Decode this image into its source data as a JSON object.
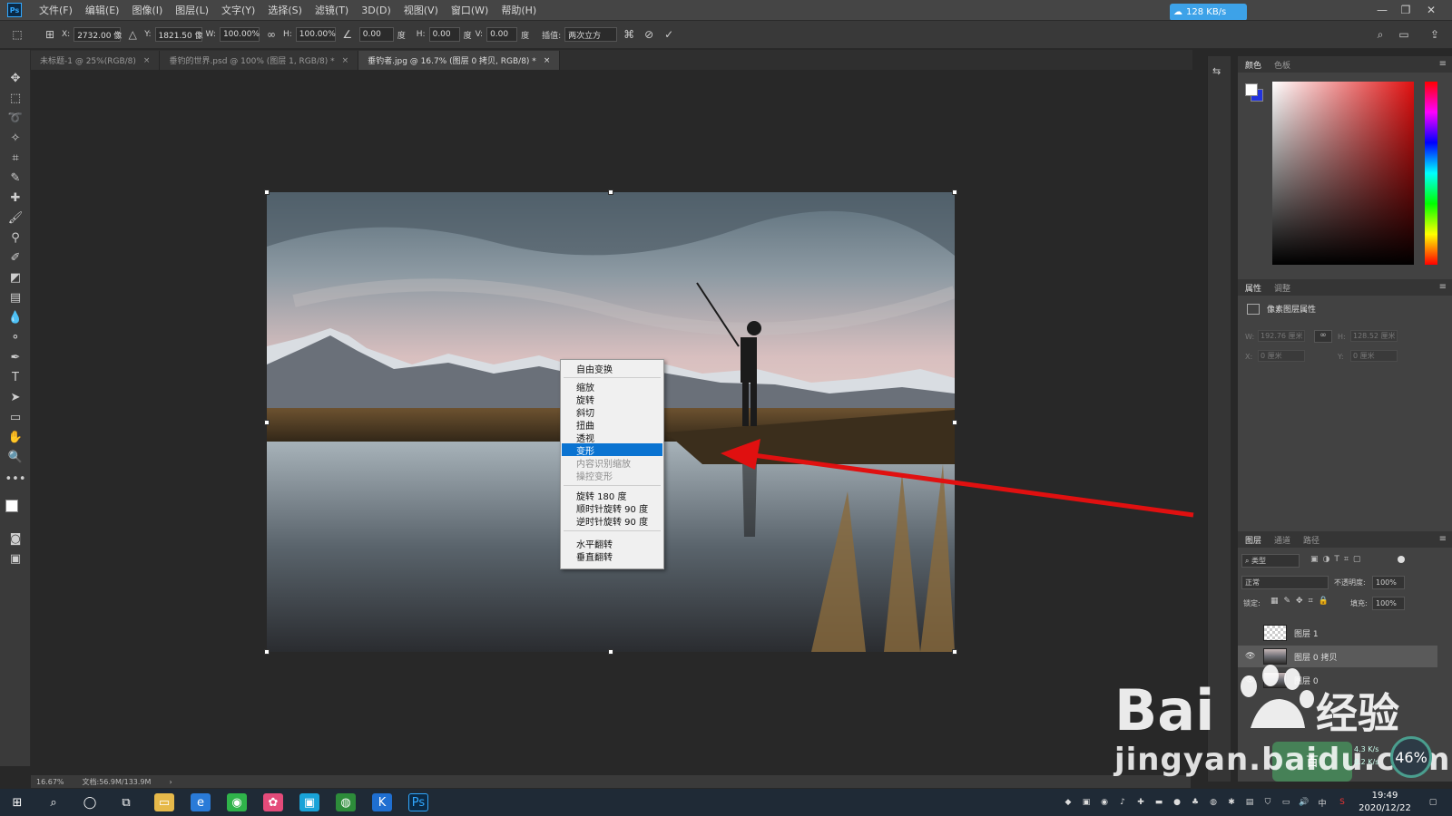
{
  "app": {
    "logo_text": "Ps"
  },
  "menu": [
    "文件(F)",
    "编辑(E)",
    "图像(I)",
    "图层(L)",
    "文字(Y)",
    "选择(S)",
    "滤镜(T)",
    "3D(D)",
    "视图(V)",
    "窗口(W)",
    "帮助(H)"
  ],
  "net_badge": "128 KB/s",
  "options": {
    "x_label": "X:",
    "x_value": "2732.00 像",
    "y_label": "Y:",
    "y_value": "1821.50 像",
    "w_label": "W:",
    "w_value": "100.00%",
    "h_label": "H:",
    "h_value": "100.00%",
    "angle_value": "0.00",
    "angle_unit": "度",
    "hskew_label": "H:",
    "hskew_value": "0.00",
    "hskew_unit": "度",
    "vskew_label": "V:",
    "vskew_value": "0.00",
    "vskew_unit": "度",
    "interp_label": "插值:",
    "interp_value": "两次立方"
  },
  "tabs": [
    {
      "label": "未标题-1 @ 25%(RGB/8)",
      "active": false
    },
    {
      "label": "垂钓的世界.psd @ 100% (图层 1, RGB/8) *",
      "active": false
    },
    {
      "label": "垂钓者.jpg @ 16.7% (图层 0 拷贝, RGB/8) *",
      "active": true
    }
  ],
  "context_menu": {
    "free_transform": "自由变换",
    "group1": [
      "缩放",
      "旋转",
      "斜切",
      "扭曲",
      "透视",
      "变形"
    ],
    "group1_disabled": [
      "内容识别缩放",
      "操控变形"
    ],
    "group2": [
      "旋转 180 度",
      "顺时针旋转 90 度",
      "逆时针旋转 90 度"
    ],
    "group3": [
      "水平翻转",
      "垂直翻转"
    ],
    "selected": "变形"
  },
  "status": {
    "zoom": "16.67%",
    "doc_size": "文档:56.9M/133.9M"
  },
  "panels": {
    "color_tabs": [
      "颜色",
      "色板"
    ],
    "props_tabs": [
      "属性",
      "调整"
    ],
    "props_title": "像素图层属性",
    "props_w_label": "W:",
    "props_w_value": "192.76 厘米",
    "props_h_label": "H:",
    "props_h_value": "128.52 厘米",
    "props_x_label": "X:",
    "props_x_value": "0 厘米",
    "props_y_label": "Y:",
    "props_y_value": "0 厘米",
    "layers_tabs": [
      "图层",
      "通道",
      "路径"
    ],
    "filter_label": "类型",
    "blend_mode": "正常",
    "opacity_label": "不透明度:",
    "opacity_value": "100%",
    "lock_label": "锁定:",
    "fill_label": "填充:",
    "fill_value": "100%",
    "layers": [
      {
        "name": "图层 1",
        "visible": false,
        "selected": false
      },
      {
        "name": "图层 0 拷贝",
        "visible": true,
        "selected": true
      },
      {
        "name": "图层 0",
        "visible": true,
        "selected": false
      }
    ]
  },
  "watermark": {
    "brand": "Bai",
    "brand_cn": "经验",
    "site": "jingyan.baidu.com",
    "badge": "百"
  },
  "speed": {
    "percent": "46%",
    "up": "4.3 K/s",
    "down": "0.2 K/s"
  },
  "clock": {
    "time": "19:49",
    "date": "2020/12/22"
  },
  "tray_ime": "中",
  "colors": {
    "accent": "#0a73d1",
    "arrow": "#e01010",
    "menubar": "#454545",
    "panel": "#424242"
  }
}
